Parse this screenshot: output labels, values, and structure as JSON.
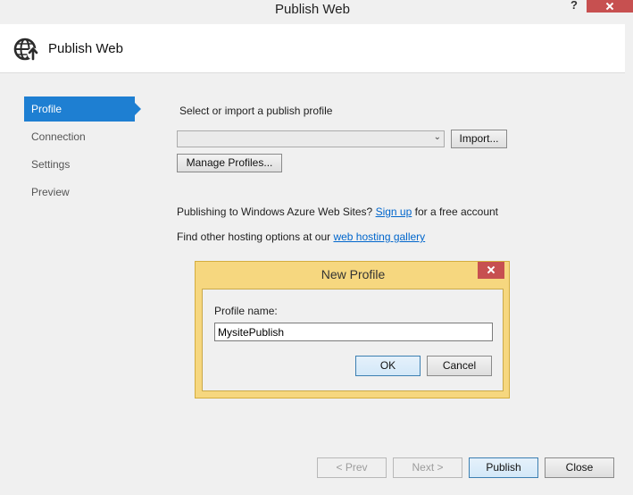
{
  "window": {
    "title": "Publish Web",
    "help_label": "?"
  },
  "header": {
    "title": "Publish Web",
    "icon": "globe-arrow-icon"
  },
  "sidebar": {
    "items": [
      {
        "label": "Profile",
        "active": true
      },
      {
        "label": "Connection"
      },
      {
        "label": "Settings"
      },
      {
        "label": "Preview"
      }
    ]
  },
  "main": {
    "select_label": "Select or import a publish profile",
    "combo_value": "",
    "import_label": "Import...",
    "manage_label": "Manage Profiles...",
    "azure_text_before": "Publishing to Windows Azure Web Sites?",
    "azure_link": "Sign up",
    "azure_text_after": "for a free account",
    "hosting_text": "Find other hosting options at our",
    "hosting_link": "web hosting gallery"
  },
  "dialog": {
    "title": "New Profile",
    "field_label": "Profile name:",
    "field_value": "MysitePublish",
    "ok_label": "OK",
    "cancel_label": "Cancel"
  },
  "footer": {
    "prev_label": "< Prev",
    "next_label": "Next >",
    "publish_label": "Publish",
    "close_label": "Close"
  },
  "colors": {
    "accent": "#1e7fd2",
    "dialog_frame": "#f6d77f",
    "close_red": "#c75050"
  }
}
